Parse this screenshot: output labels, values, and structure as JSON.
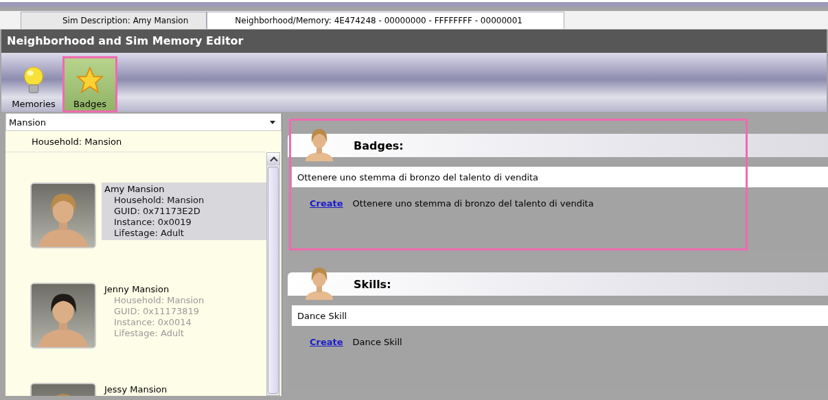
{
  "tabs": [
    {
      "label": "Sim Description: Amy Mansion",
      "selected": false
    },
    {
      "label": "Neighborhood/Memory: 4E474248 - 00000000 - FFFFFFFF - 00000001",
      "selected": true
    }
  ],
  "window": {
    "title": "Neighborhood and Sim Memory Editor"
  },
  "toolbar": [
    {
      "label": "Memories",
      "kind": "bulb",
      "selected": false,
      "highlighted": false
    },
    {
      "label": "Badges",
      "kind": "star",
      "selected": true,
      "highlighted": true
    }
  ],
  "household_select": {
    "value": "Mansion"
  },
  "household_header": "Household: Mansion",
  "sims": [
    {
      "name": "Amy Mansion",
      "selected": true,
      "details": [
        "Household: Mansion",
        "GUID: 0x71173E2D",
        "Instance: 0x0019",
        "Lifestage: Adult"
      ]
    },
    {
      "name": "Jenny Mansion",
      "selected": false,
      "details": [
        "Household: Mansion",
        "GUID: 0x11173819",
        "Instance: 0x0014",
        "Lifestage: Adult"
      ]
    },
    {
      "name": "Jessy Mansion",
      "selected": false
    }
  ],
  "sections": [
    {
      "title": "Badges:",
      "value": "Ottenere uno stemma di bronzo del talento di vendita",
      "link": "Create",
      "description": "Ottenere uno stemma di bronzo del talento di vendita",
      "highlighted": true
    },
    {
      "title": "Skills:",
      "value": "Dance Skill",
      "link": "Create",
      "description": "Dance Skill",
      "highlighted": false
    }
  ]
}
